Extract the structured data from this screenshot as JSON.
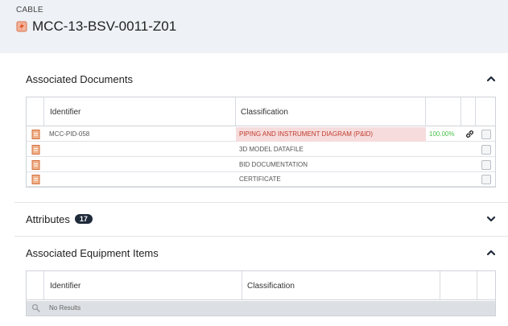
{
  "header": {
    "kind": "CABLE",
    "title": "MCC-13-BSV-0011-Z01",
    "icon": "cable-icon"
  },
  "documents": {
    "title": "Associated Documents",
    "columns": [
      "Identifier",
      "Classification"
    ],
    "rows": [
      {
        "identifier": "MCC-PID-058",
        "classification": "PIPING AND INSTRUMENT DIAGRAM (P&ID)",
        "percent": "100.00%",
        "highlighted": true,
        "linked": true
      },
      {
        "identifier": "",
        "classification": "3D MODEL DATAFILE",
        "percent": "",
        "highlighted": false,
        "linked": false
      },
      {
        "identifier": "",
        "classification": "BID DOCUMENTATION",
        "percent": "",
        "highlighted": false,
        "linked": false
      },
      {
        "identifier": "",
        "classification": "CERTIFICATE",
        "percent": "",
        "highlighted": false,
        "linked": false
      }
    ]
  },
  "attributes": {
    "title": "Attributes",
    "count": "17"
  },
  "equipment": {
    "title": "Associated Equipment Items",
    "columns": [
      "Identifier",
      "Classification"
    ],
    "no_results": "No Results"
  },
  "colors": {
    "highlight_bg": "#f6dcdc",
    "highlight_text": "#c0392b",
    "percent_text": "#4cc14c",
    "badge_bg": "#1f2a3a",
    "header_bg": "#eef1f5"
  }
}
